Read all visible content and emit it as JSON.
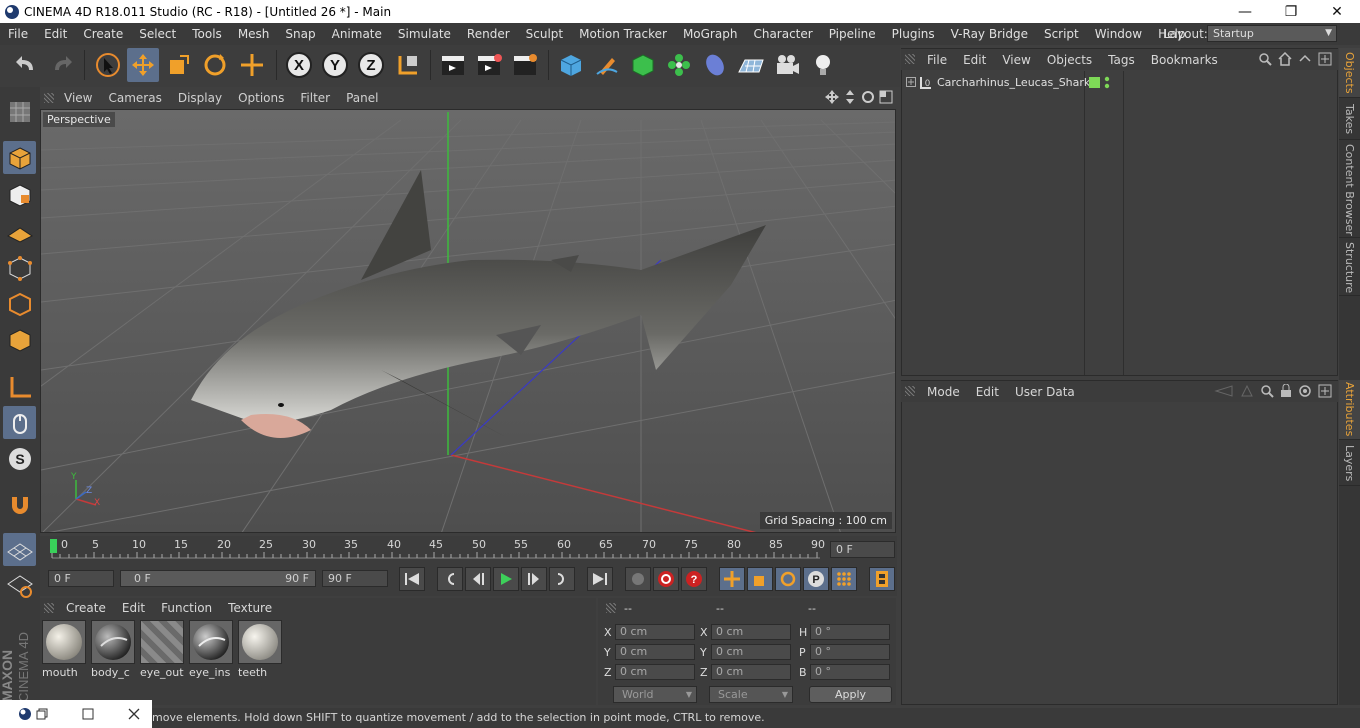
{
  "window": {
    "title": "CINEMA 4D R18.011 Studio (RC - R18) - [Untitled 26 *] - Main",
    "minimize": "—",
    "maximize": "❐",
    "close": "✕"
  },
  "menubar": {
    "items": [
      "File",
      "Edit",
      "Create",
      "Select",
      "Tools",
      "Mesh",
      "Snap",
      "Animate",
      "Simulate",
      "Render",
      "Sculpt",
      "Motion Tracker",
      "MoGraph",
      "Character",
      "Pipeline",
      "Plugins",
      "V-Ray Bridge",
      "Script",
      "Window",
      "Help"
    ],
    "layout_label": "Layout:",
    "layout_value": "Startup"
  },
  "viewport": {
    "menu": [
      "View",
      "Cameras",
      "Display",
      "Options",
      "Filter",
      "Panel"
    ],
    "label": "Perspective",
    "grid_spacing": "Grid Spacing : 100 cm",
    "axis_x": "X",
    "axis_y": "Y",
    "axis_z": "Z"
  },
  "timeline": {
    "ticks": [
      "0",
      "5",
      "10",
      "15",
      "20",
      "25",
      "30",
      "35",
      "40",
      "45",
      "50",
      "55",
      "60",
      "65",
      "70",
      "75",
      "80",
      "85",
      "90"
    ],
    "current_frame": "0 F",
    "start_frame": "0 F",
    "range_start": "0 F",
    "range_end": "90 F",
    "end_frame": "90 F"
  },
  "materials": {
    "menu": [
      "Create",
      "Edit",
      "Function",
      "Texture"
    ],
    "items": [
      {
        "name": "mouth",
        "color": "#d9d4c5"
      },
      {
        "name": "body_c",
        "color": "#4a4a4a"
      },
      {
        "name": "eye_out",
        "color": "#8a8a8a"
      },
      {
        "name": "eye_ins",
        "color": "#555555"
      },
      {
        "name": "teeth",
        "color": "#e0ddd2"
      }
    ]
  },
  "coordinates": {
    "headers": [
      "--",
      "--",
      "--"
    ],
    "pos_labels": [
      "X",
      "Y",
      "Z"
    ],
    "pos_values": [
      "0 cm",
      "0 cm",
      "0 cm"
    ],
    "size_labels": [
      "X",
      "Y",
      "Z"
    ],
    "size_values": [
      "0 cm",
      "0 cm",
      "0 cm"
    ],
    "rot_labels": [
      "H",
      "P",
      "B"
    ],
    "rot_values": [
      "0 °",
      "0 °",
      "0 °"
    ],
    "world": "World",
    "scale": "Scale",
    "apply": "Apply"
  },
  "objects": {
    "menu": [
      "File",
      "Edit",
      "View",
      "Objects",
      "Tags",
      "Bookmarks"
    ],
    "tree": [
      {
        "name": "Carcharhinus_Leucas_Shark"
      }
    ]
  },
  "attributes": {
    "menu": [
      "Mode",
      "Edit",
      "User Data"
    ]
  },
  "right_tabs": [
    "Objects",
    "Takes",
    "Content Browser",
    "Structure",
    "Attributes",
    "Layers"
  ],
  "statusbar": {
    "text": "move elements. Hold down SHIFT to quantize movement / add to the selection in point mode, CTRL to remove."
  },
  "brand": {
    "maxon": "MAXON",
    "cinema": "CINEMA 4D"
  },
  "colors": {
    "accent": "#5c6f8c",
    "active_tab": "#e8a33a",
    "selection_green": "#7ed957"
  }
}
